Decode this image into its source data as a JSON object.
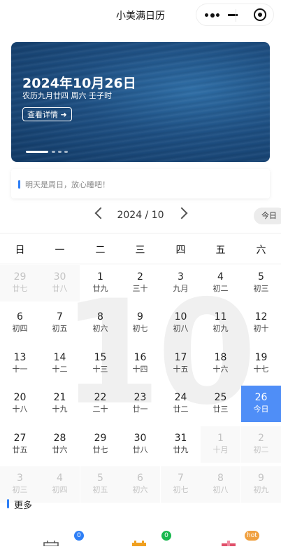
{
  "nav": {
    "title": "小美满日历"
  },
  "banner": {
    "date": "2024年10月26日",
    "lunar": "农历九月廿四 周六 壬子时",
    "detail_label": "查看详情 ➜"
  },
  "notice": {
    "text": "明天是周日，放心睡吧！"
  },
  "calendar": {
    "year_month": "2024 / 10",
    "today_label": "今日",
    "weekdays": [
      "日",
      "一",
      "二",
      "三",
      "四",
      "五",
      "六"
    ],
    "watermark": "10",
    "days": [
      {
        "d": "29",
        "l": "廿七",
        "other": true
      },
      {
        "d": "30",
        "l": "廿八",
        "other": true
      },
      {
        "d": "1",
        "l": "廿九"
      },
      {
        "d": "2",
        "l": "三十"
      },
      {
        "d": "3",
        "l": "九月"
      },
      {
        "d": "4",
        "l": "初二"
      },
      {
        "d": "5",
        "l": "初三"
      },
      {
        "d": "6",
        "l": "初四"
      },
      {
        "d": "7",
        "l": "初五"
      },
      {
        "d": "8",
        "l": "初六"
      },
      {
        "d": "9",
        "l": "初七"
      },
      {
        "d": "10",
        "l": "初八"
      },
      {
        "d": "11",
        "l": "初九"
      },
      {
        "d": "12",
        "l": "初十"
      },
      {
        "d": "13",
        "l": "十一"
      },
      {
        "d": "14",
        "l": "十二"
      },
      {
        "d": "15",
        "l": "十三"
      },
      {
        "d": "16",
        "l": "十四"
      },
      {
        "d": "17",
        "l": "十五"
      },
      {
        "d": "18",
        "l": "十六"
      },
      {
        "d": "19",
        "l": "十七"
      },
      {
        "d": "20",
        "l": "十八"
      },
      {
        "d": "21",
        "l": "十九"
      },
      {
        "d": "22",
        "l": "二十"
      },
      {
        "d": "23",
        "l": "廿一"
      },
      {
        "d": "24",
        "l": "廿二"
      },
      {
        "d": "25",
        "l": "廿三"
      },
      {
        "d": "26",
        "l": "今日",
        "today": true
      },
      {
        "d": "27",
        "l": "廿五"
      },
      {
        "d": "28",
        "l": "廿六"
      },
      {
        "d": "29",
        "l": "廿七"
      },
      {
        "d": "30",
        "l": "廿八"
      },
      {
        "d": "31",
        "l": "廿九"
      },
      {
        "d": "1",
        "l": "十月",
        "other": true
      },
      {
        "d": "2",
        "l": "初二",
        "other": true
      },
      {
        "d": "3",
        "l": "初三",
        "other": true
      },
      {
        "d": "4",
        "l": "初四",
        "other": true
      },
      {
        "d": "5",
        "l": "初五",
        "other": true
      },
      {
        "d": "6",
        "l": "初六",
        "other": true
      },
      {
        "d": "7",
        "l": "初七",
        "other": true
      },
      {
        "d": "8",
        "l": "初八",
        "other": true
      },
      {
        "d": "9",
        "l": "初九",
        "other": true
      }
    ]
  },
  "more": {
    "label": "更多"
  },
  "tools": [
    {
      "badge": "0",
      "badge_color": "#2e7ff6",
      "icon_color": "#555555"
    },
    {
      "badge": "0",
      "badge_color": "#19b84f",
      "icon_color": "#f0a020"
    },
    {
      "badge": "hot",
      "badge_color": "#f0a040",
      "icon_color": "#e0506a"
    }
  ]
}
